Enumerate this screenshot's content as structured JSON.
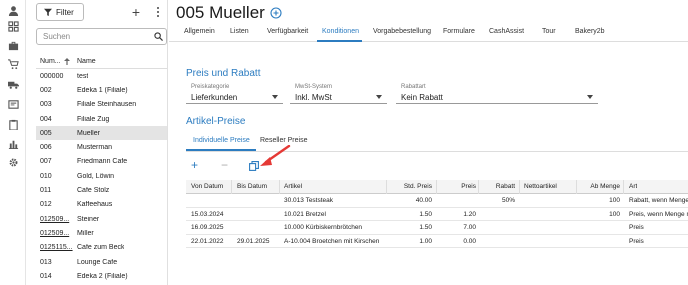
{
  "rail": {
    "icons": [
      "user-icon",
      "dashboard-icon",
      "briefcase-icon",
      "cart-icon",
      "truck-icon",
      "register-icon",
      "clipboard-icon",
      "chart-icon",
      "gear-icon"
    ]
  },
  "list": {
    "filter_label": "Filter",
    "add_label": "+",
    "search_placeholder": "Suchen",
    "col_number": "Num...",
    "col_name": "Name",
    "rows": [
      {
        "num": "000000",
        "name": "test"
      },
      {
        "num": "002",
        "name": "Edeka 1 (Filiale)"
      },
      {
        "num": "003",
        "name": "Filiale Steinhausen"
      },
      {
        "num": "004",
        "name": "Filiale Zug"
      },
      {
        "num": "005",
        "name": "Mueller"
      },
      {
        "num": "006",
        "name": "Musterman"
      },
      {
        "num": "007",
        "name": "Friedmann Cafe"
      },
      {
        "num": "010",
        "name": "Gold, Löwin"
      },
      {
        "num": "011",
        "name": "Cafe Stolz"
      },
      {
        "num": "012",
        "name": "Kaffeehaus"
      },
      {
        "num": "012509...",
        "name": "Steiner"
      },
      {
        "num": "012509...",
        "name": "Miller"
      },
      {
        "num": "0125115...",
        "name": "Cafe zum Beck"
      },
      {
        "num": "013",
        "name": "Lounge Cafe"
      },
      {
        "num": "014",
        "name": "Edeka 2 (Filiale)"
      }
    ]
  },
  "main": {
    "title": "005 Mueller",
    "tabs": [
      "Allgemein",
      "Listen",
      "Verfügbarkeit",
      "Konditionen",
      "Vorgabebestellung",
      "Formulare",
      "CashAssist",
      "Tour",
      "Bakery2b"
    ],
    "section_price": "Preis und Rabatt",
    "fields": [
      {
        "label": "Preiskategorie",
        "value": "Lieferkunden"
      },
      {
        "label": "MwSt-System",
        "value": "Inkl. MwSt"
      },
      {
        "label": "Rabattart",
        "value": "Kein Rabatt"
      }
    ],
    "section_article": "Artikel-Preise",
    "subtabs": [
      "Individuelle Preise",
      "Reseller Preise"
    ],
    "toolbar": {
      "add": "+",
      "remove": "−"
    },
    "grid": {
      "headers": [
        "Von Datum",
        "Bis Datum",
        "Artikel",
        "Std. Preis",
        "Preis",
        "Rabatt",
        "Nettoartikel",
        "Ab Menge",
        "Art"
      ],
      "rows": [
        [
          "",
          "",
          "30.013 Teststeak",
          "40.00",
          "",
          "50%",
          "",
          "100",
          "Rabatt, wenn Menge..."
        ],
        [
          "15.03.2024",
          "",
          "10.021 Bretzel",
          "1.50",
          "1.20",
          "",
          "",
          "100",
          "Preis, wenn Menge m..."
        ],
        [
          "16.09.2025",
          "",
          "10.000 Kürbiskernbrötchen",
          "1.50",
          "7.00",
          "",
          "",
          "",
          "Preis"
        ],
        [
          "22.01.2022",
          "29.01.2025",
          "A-10.004 Broetchen mit Kirschen",
          "1.00",
          "0.00",
          "",
          "",
          "",
          "Preis"
        ]
      ]
    }
  },
  "colors": {
    "accent": "#2c7cc0",
    "arrow": "#e53935",
    "selected_row": "#e4e4e4"
  }
}
